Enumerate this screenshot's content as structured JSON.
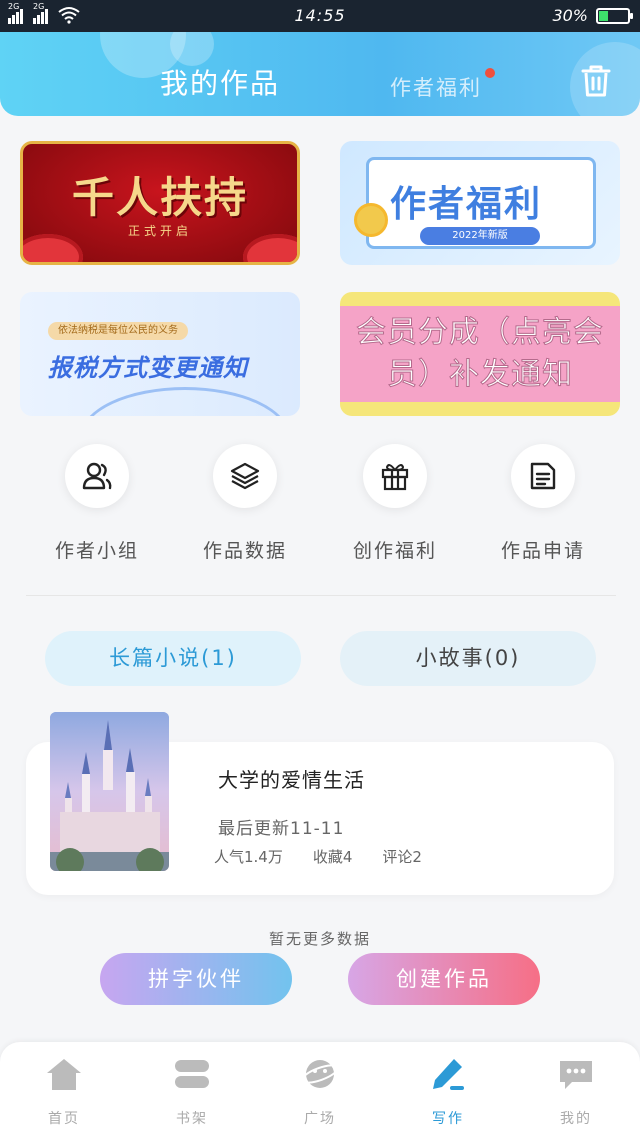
{
  "status_bar": {
    "sim1": "2G",
    "sim2": "2G",
    "time": "14:55",
    "battery_text": "30%",
    "battery_level": 0.3
  },
  "header": {
    "title": "我的作品",
    "secondary_tab": "作者福利",
    "trash_icon": "trash-icon"
  },
  "banners": [
    {
      "title": "千人扶持",
      "subtitle": "正式开启"
    },
    {
      "title": "作者福利",
      "pill": "2022年新版"
    },
    {
      "tag": "依法纳税是每位公民的义务",
      "title": "报税方式变更通知"
    },
    {
      "title": "会员分成（点亮会员）补发通知"
    }
  ],
  "quick_actions": [
    {
      "label": "作者小组",
      "icon": "user-group-icon"
    },
    {
      "label": "作品数据",
      "icon": "layers-icon"
    },
    {
      "label": "创作福利",
      "icon": "gift-icon"
    },
    {
      "label": "作品申请",
      "icon": "document-icon"
    }
  ],
  "categories": {
    "long_novel": "长篇小说(1)",
    "short_story": "小故事(0)"
  },
  "work": {
    "title": "大学的爱情生活",
    "updated": "最后更新11-11",
    "popularity": "人气1.4万",
    "favorites": "收藏4",
    "comments": "评论2"
  },
  "no_more": "暂无更多数据",
  "buttons": {
    "partner": "拼字伙伴",
    "create": "创建作品"
  },
  "nav": [
    {
      "label": "首页",
      "icon": "home-icon"
    },
    {
      "label": "书架",
      "icon": "bookshelf-icon"
    },
    {
      "label": "广场",
      "icon": "planet-icon"
    },
    {
      "label": "写作",
      "icon": "pen-icon",
      "active": true
    },
    {
      "label": "我的",
      "icon": "chat-icon"
    }
  ],
  "colors": {
    "accent": "#2c9ad6",
    "header_start": "#5fd3f5",
    "header_end": "#4fb8f0",
    "notification_dot": "#f0503e"
  }
}
